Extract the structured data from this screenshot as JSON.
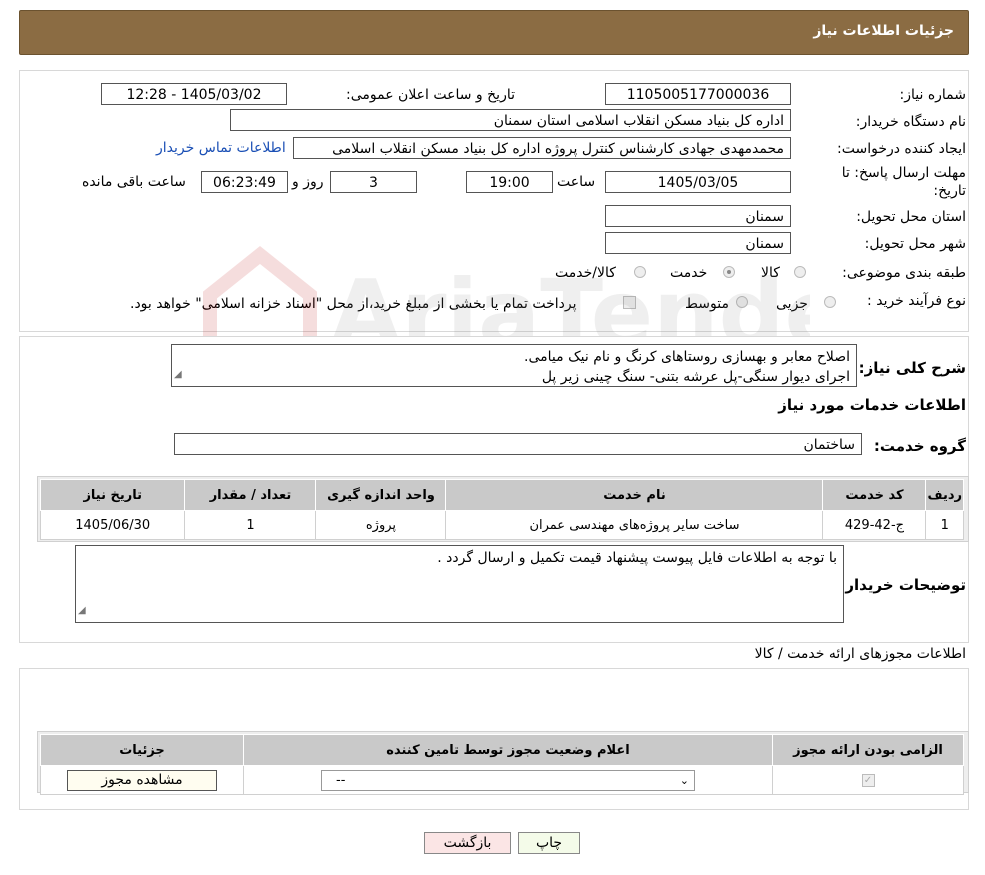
{
  "header": {
    "title": "جزئیات اطلاعات نیاز"
  },
  "form": {
    "need_number_label": "شماره نیاز:",
    "need_number": "1105005177000036",
    "announce_label": "تاریخ و ساعت اعلان عمومی:",
    "announce_value": "1405/03/02 - 12:28",
    "buyer_org_label": "نام دستگاه خریدار:",
    "buyer_org": "اداره کل بنیاد مسکن انقلاب اسلامی استان سمنان",
    "creator_label": "ایجاد کننده درخواست:",
    "creator": "محمدمهدی جهادی کارشناس کنترل پروژه اداره کل بنیاد مسکن انقلاب اسلامی",
    "contact_link": "اطلاعات تماس خریدار",
    "deadline_label_1": "مهلت ارسال پاسخ: تا",
    "deadline_label_2": "تاریخ:",
    "deadline_date": "1405/03/05",
    "time_label": "ساعت",
    "deadline_time": "19:00",
    "days": "3",
    "days_label": "روز و",
    "remaining": "06:23:49",
    "remaining_label": "ساعت باقی مانده",
    "province_label": "استان محل تحویل:",
    "province": "سمنان",
    "city_label": "شهر محل تحویل:",
    "city": "سمنان",
    "category_label": "طبقه بندی موضوعی:",
    "category_options": [
      "کالا",
      "خدمت",
      "کالا/خدمت"
    ],
    "process_label": "نوع فرآیند خرید :",
    "process_options": [
      "جزیی",
      "متوسط"
    ],
    "payment_note": "پرداخت تمام یا بخشی از مبلغ خرید،از محل \"اسناد خزانه اسلامی\" خواهد بود."
  },
  "summary": {
    "label": "شرح کلی نیاز:",
    "line1": "اصلاح معابر و بهسازی روستاهای کرنگ و نام نیک میامی.",
    "line2": "اجرای دیوار سنگی-پل عرشه بتنی- سنگ چینی زیر پل"
  },
  "services": {
    "section_title": "اطلاعات خدمات مورد نیاز",
    "group_label": "گروه خدمت:",
    "group_value": "ساختمان",
    "columns": [
      "ردیف",
      "کد خدمت",
      "نام خدمت",
      "واحد اندازه گیری",
      "تعداد / مقدار",
      "تاریخ نیاز"
    ],
    "rows": [
      {
        "row": "1",
        "code": "ج-42-429",
        "name": "ساخت سایر پروژه‌های مهندسی عمران",
        "unit": "پروژه",
        "qty": "1",
        "date": "1405/06/30"
      }
    ]
  },
  "buyer_notes": {
    "label": "توضیحات خریدار:",
    "text": "با توجه به اطلاعات فایل پیوست پیشنهاد قیمت تکمیل و ارسال گردد  ."
  },
  "permits": {
    "section_title": "اطلاعات مجوزهای ارائه خدمت / کالا",
    "columns": [
      "الزامی بودن ارائه مجوز",
      "اعلام وضعیت مجوز توسط تامین کننده",
      "جزئیات"
    ],
    "select_value": "--",
    "view_button": "مشاهده مجوز"
  },
  "footer": {
    "print_button": "چاپ",
    "back_button": "بازگشت"
  },
  "watermark": {
    "text": "AriaTender.neT"
  }
}
